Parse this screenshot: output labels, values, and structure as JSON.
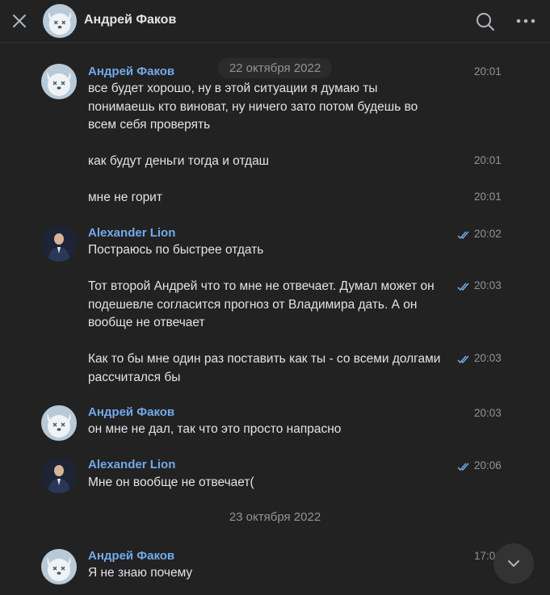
{
  "header": {
    "title": "Андрей Факов"
  },
  "dates": [
    "22 октября 2022",
    "23 октября 2022"
  ],
  "messages": [
    {
      "author": "Андрей Факов",
      "text": "все будет хорошо, ну в этой ситуации я думаю ты понимаешь кто виноват, ну ничего зато потом будешь во всем себя проверять",
      "time": "20:01"
    },
    {
      "text": "как будут деньги тогда и отдаш",
      "time": "20:01"
    },
    {
      "text": "мне не горит",
      "time": "20:01"
    },
    {
      "author": "Alexander Lion",
      "text": "Постраюсь по быстрее отдать",
      "time": "20:02"
    },
    {
      "text": "Тот второй Андрей что то мне не отвечает. Думал может он подешевле согласится прогноз от Владимира дать. А он вообще не отвечает",
      "time": "20:03"
    },
    {
      "text": "Как то бы мне один раз поставить как ты - со всеми долгами рассчитался бы",
      "time": "20:03"
    },
    {
      "author": "Андрей Факов",
      "text": "он мне не дал, так что это просто напрасно",
      "time": "20:03"
    },
    {
      "author": "Alexander Lion",
      "text": "Мне он вообще не отвечает(",
      "time": "20:06"
    },
    {
      "author": "Андрей Факов",
      "text": "Я не знаю почему",
      "time": "17:0"
    }
  ],
  "colors": {
    "background": "#222222",
    "author_link": "#71aaeb",
    "text": "#e1e3e6",
    "muted": "#939393",
    "read_check": "#71aaeb"
  },
  "icons": [
    "close-icon",
    "search-icon",
    "more-icon",
    "read-check-icon",
    "chevron-down-icon"
  ]
}
